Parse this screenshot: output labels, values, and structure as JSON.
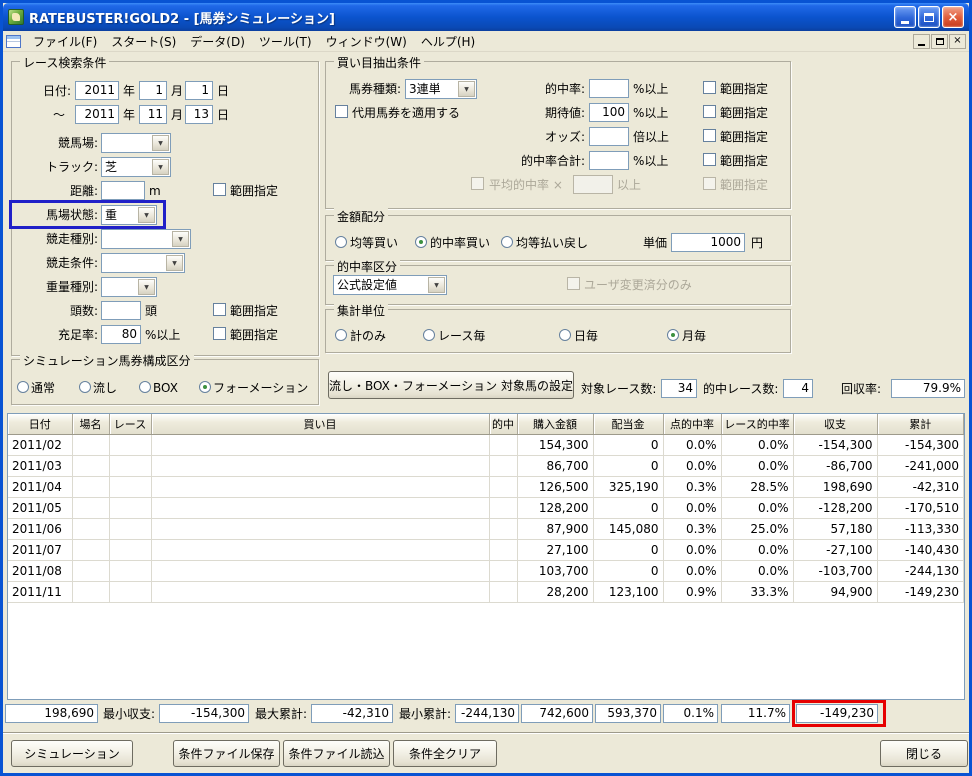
{
  "colors": {
    "ground_highlight": "#2020C8",
    "balance_highlight": "#E60000",
    "titlebar_blue": "#0B54CE"
  },
  "icons": {
    "dropdown_glyph": "▼",
    "close_glyph": "×"
  },
  "window": {
    "title": "RATEBUSTER!GOLD2 - [馬券シミュレーション]",
    "menu": [
      "ファイル(F)",
      "スタート(S)",
      "データ(D)",
      "ツール(T)",
      "ウィンドウ(W)",
      "ヘルプ(H)"
    ]
  },
  "search": {
    "title": "レース検索条件",
    "labels": {
      "date": "日付:",
      "tilde": "～",
      "year": "年",
      "month": "月",
      "day": "日",
      "course": "競馬場:",
      "track": "トラック:",
      "distance": "距離:",
      "distance_unit": "m",
      "ground": "馬場状態:",
      "race_type": "競走種別:",
      "race_cond": "競走条件:",
      "weight_type": "重量種別:",
      "heads": "頭数:",
      "heads_unit": "頭",
      "fill_rate": "充足率:",
      "pct_over": "%以上",
      "range": "範囲指定"
    },
    "values": {
      "from_year": "2011",
      "from_month": "1",
      "from_day": "1",
      "to_year": "2011",
      "to_month": "11",
      "to_day": "13",
      "course": "",
      "track": "芝",
      "distance": "",
      "ground": "重",
      "race_type": "",
      "race_cond": "",
      "weight_type": "",
      "heads": "",
      "fill_rate": "80"
    }
  },
  "extract": {
    "title": "買い目抽出条件",
    "labels": {
      "ticket": "馬券種類:",
      "substitute": "代用馬券を適用する",
      "hit": "的中率:",
      "expect": "期待値:",
      "odds": "オッズ:",
      "odds_unit": "倍以上",
      "hit_total": "的中率合計:",
      "avg_hit": "平均的中率 ×",
      "over": "以上",
      "pct_over": "%以上",
      "range": "範囲指定"
    },
    "values": {
      "ticket": "3連単",
      "hit": "",
      "expect": "100",
      "odds": "",
      "hit_total": "",
      "avg_hit": ""
    }
  },
  "amount": {
    "title": "金額配分",
    "options": [
      "均等買い",
      "的中率買い",
      "均等払い戻し"
    ],
    "selected": 1,
    "unit_label": "単価",
    "unit_value": "1000",
    "unit_suffix": "円"
  },
  "hit_class": {
    "title": "的中率区分",
    "value": "公式設定値",
    "user_only": "ユーザ変更済分のみ"
  },
  "aggregate": {
    "title": "集計単位",
    "options": [
      "計のみ",
      "レース毎",
      "日毎",
      "月毎"
    ],
    "selected": 3
  },
  "sim_type": {
    "title": "シミュレーション馬券構成区分",
    "options": [
      "通常",
      "流し",
      "BOX",
      "フォーメーション"
    ],
    "selected": 3
  },
  "target_button": "流し・BOX・フォーメーション 対象馬の設定",
  "stats": {
    "races_label": "対象レース数:",
    "races": "34",
    "hit_races_label": "的中レース数:",
    "hit_races": "4",
    "recovery_label": "回収率:",
    "recovery": "79.9%"
  },
  "table": {
    "headers": [
      "日付",
      "場名",
      "レース",
      "買い目",
      "的中",
      "購入金額",
      "配当金",
      "点的中率",
      "レース的中率",
      "収支",
      "累計"
    ],
    "rows": [
      [
        "2011/02",
        "",
        "",
        "",
        "",
        "154,300",
        "0",
        "0.0%",
        "0.0%",
        "-154,300",
        "-154,300"
      ],
      [
        "2011/03",
        "",
        "",
        "",
        "",
        "86,700",
        "0",
        "0.0%",
        "0.0%",
        "-86,700",
        "-241,000"
      ],
      [
        "2011/04",
        "",
        "",
        "",
        "",
        "126,500",
        "325,190",
        "0.3%",
        "28.5%",
        "198,690",
        "-42,310"
      ],
      [
        "2011/05",
        "",
        "",
        "",
        "",
        "128,200",
        "0",
        "0.0%",
        "0.0%",
        "-128,200",
        "-170,510"
      ],
      [
        "2011/06",
        "",
        "",
        "",
        "",
        "87,900",
        "145,080",
        "0.3%",
        "25.0%",
        "57,180",
        "-113,330"
      ],
      [
        "2011/07",
        "",
        "",
        "",
        "",
        "27,100",
        "0",
        "0.0%",
        "0.0%",
        "-27,100",
        "-140,430"
      ],
      [
        "2011/08",
        "",
        "",
        "",
        "",
        "103,700",
        "0",
        "0.0%",
        "0.0%",
        "-103,700",
        "-244,130"
      ],
      [
        "2011/11",
        "",
        "",
        "",
        "",
        "28,200",
        "123,100",
        "0.9%",
        "33.3%",
        "94,900",
        "-149,230"
      ]
    ]
  },
  "summary": {
    "max_balance": "198,690",
    "min_balance_label": "最小収支:",
    "min_balance": "-154,300",
    "max_total_label": "最大累計:",
    "max_total": "-42,310",
    "min_total_label": "最小累計:",
    "min_total": "-244,130",
    "total_purchase": "742,600",
    "total_payout": "593,370",
    "point_hit_rate": "0.1%",
    "race_hit_rate": "11.7%",
    "final_balance": "-149,230"
  },
  "footer": {
    "simulate": "シミュレーション",
    "save": "条件ファイル保存",
    "load": "条件ファイル読込",
    "clear": "条件全クリア",
    "close": "閉じる"
  }
}
